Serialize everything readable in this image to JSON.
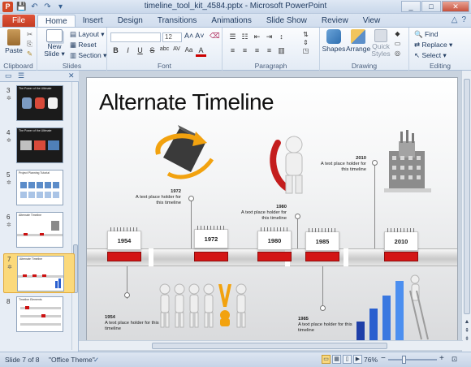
{
  "titlebar": {
    "title": "timeline_tool_kit_4584.pptx - Microsoft PowerPoint",
    "app_icon": "P",
    "qat_icons": [
      "save-icon",
      "undo-icon",
      "redo-icon",
      "customize-icon"
    ],
    "win_buttons": [
      "_",
      "□",
      "✕"
    ]
  },
  "tabs": {
    "file": "File",
    "items": [
      "Home",
      "Insert",
      "Design",
      "Transitions",
      "Animations",
      "Slide Show",
      "Review",
      "View"
    ],
    "active": "Home"
  },
  "ribbon": {
    "clipboard": {
      "paste": "Paste",
      "label": "Clipboard"
    },
    "slides": {
      "new_slide": "New Slide ▾",
      "layout": "Layout ▾",
      "reset": "Reset",
      "section": "Section ▾",
      "label": "Slides"
    },
    "font": {
      "family": "",
      "size": "12",
      "label": "Font",
      "buttons": [
        "B",
        "I",
        "U",
        "S",
        "abc",
        "AV",
        "Aa",
        "A"
      ]
    },
    "paragraph": {
      "label": "Paragraph"
    },
    "drawing": {
      "shapes": "Shapes",
      "arrange": "Arrange",
      "quick_styles": "Quick Styles",
      "label": "Drawing"
    },
    "editing": {
      "find": "Find",
      "replace": "Replace ▾",
      "select": "Select ▾",
      "label": "Editing"
    }
  },
  "leftpanel": {
    "thumbs": [
      {
        "num": "3",
        "title": "The Power of the Ultimate"
      },
      {
        "num": "4",
        "title": "The Power of the Ultimate"
      },
      {
        "num": "5",
        "title": "Project Planning Tutorial"
      },
      {
        "num": "6",
        "title": "Alternate Timeline"
      },
      {
        "num": "7",
        "title": "Alternate Timeline"
      },
      {
        "num": "8",
        "title": "Timeline Elements"
      }
    ]
  },
  "slide": {
    "title": "Alternate Timeline",
    "upper": [
      {
        "year": "1972",
        "text": "A text place holder for this timeline"
      },
      {
        "year": "1980",
        "text": "A text place holder for this timeline"
      },
      {
        "year": "2010",
        "text": "A text place holder for this timeline"
      }
    ],
    "lower": [
      {
        "year": "1954",
        "text": "A text place holder for this timeline"
      },
      {
        "year": "1985",
        "text": "A text place holder for this timeline"
      }
    ],
    "calendars": [
      "1954",
      "1972",
      "1980",
      "1985",
      "2010"
    ]
  },
  "statusbar": {
    "slide": "Slide 7 of 8",
    "theme": "\"Office Theme\"",
    "zoom": "76%"
  },
  "colors": {
    "accent_red": "#cc1111",
    "file_tab": "#c23b22",
    "selected_thumb": "#fbd97b"
  }
}
